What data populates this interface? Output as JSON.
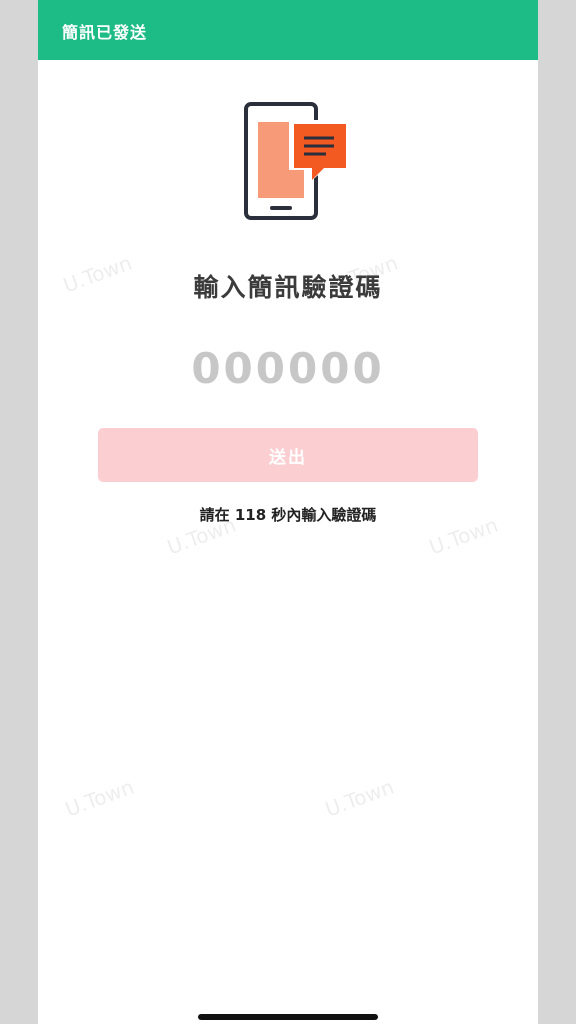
{
  "banner": {
    "text": "簡訊已發送"
  },
  "hero": {
    "icon": "phone-message-icon"
  },
  "heading": "輸入簡訊驗證碼",
  "code_input": {
    "value": "",
    "placeholder": "000000"
  },
  "submit_label": "送出",
  "countdown": {
    "seconds": 118,
    "text": "請在 118 秒內輸入驗證碼"
  },
  "watermark": "U.Town",
  "colors": {
    "banner": "#1dbb86",
    "button": "#fbcfd2",
    "accent_orange": "#f25a22",
    "phone_screen": "#f79a78"
  }
}
